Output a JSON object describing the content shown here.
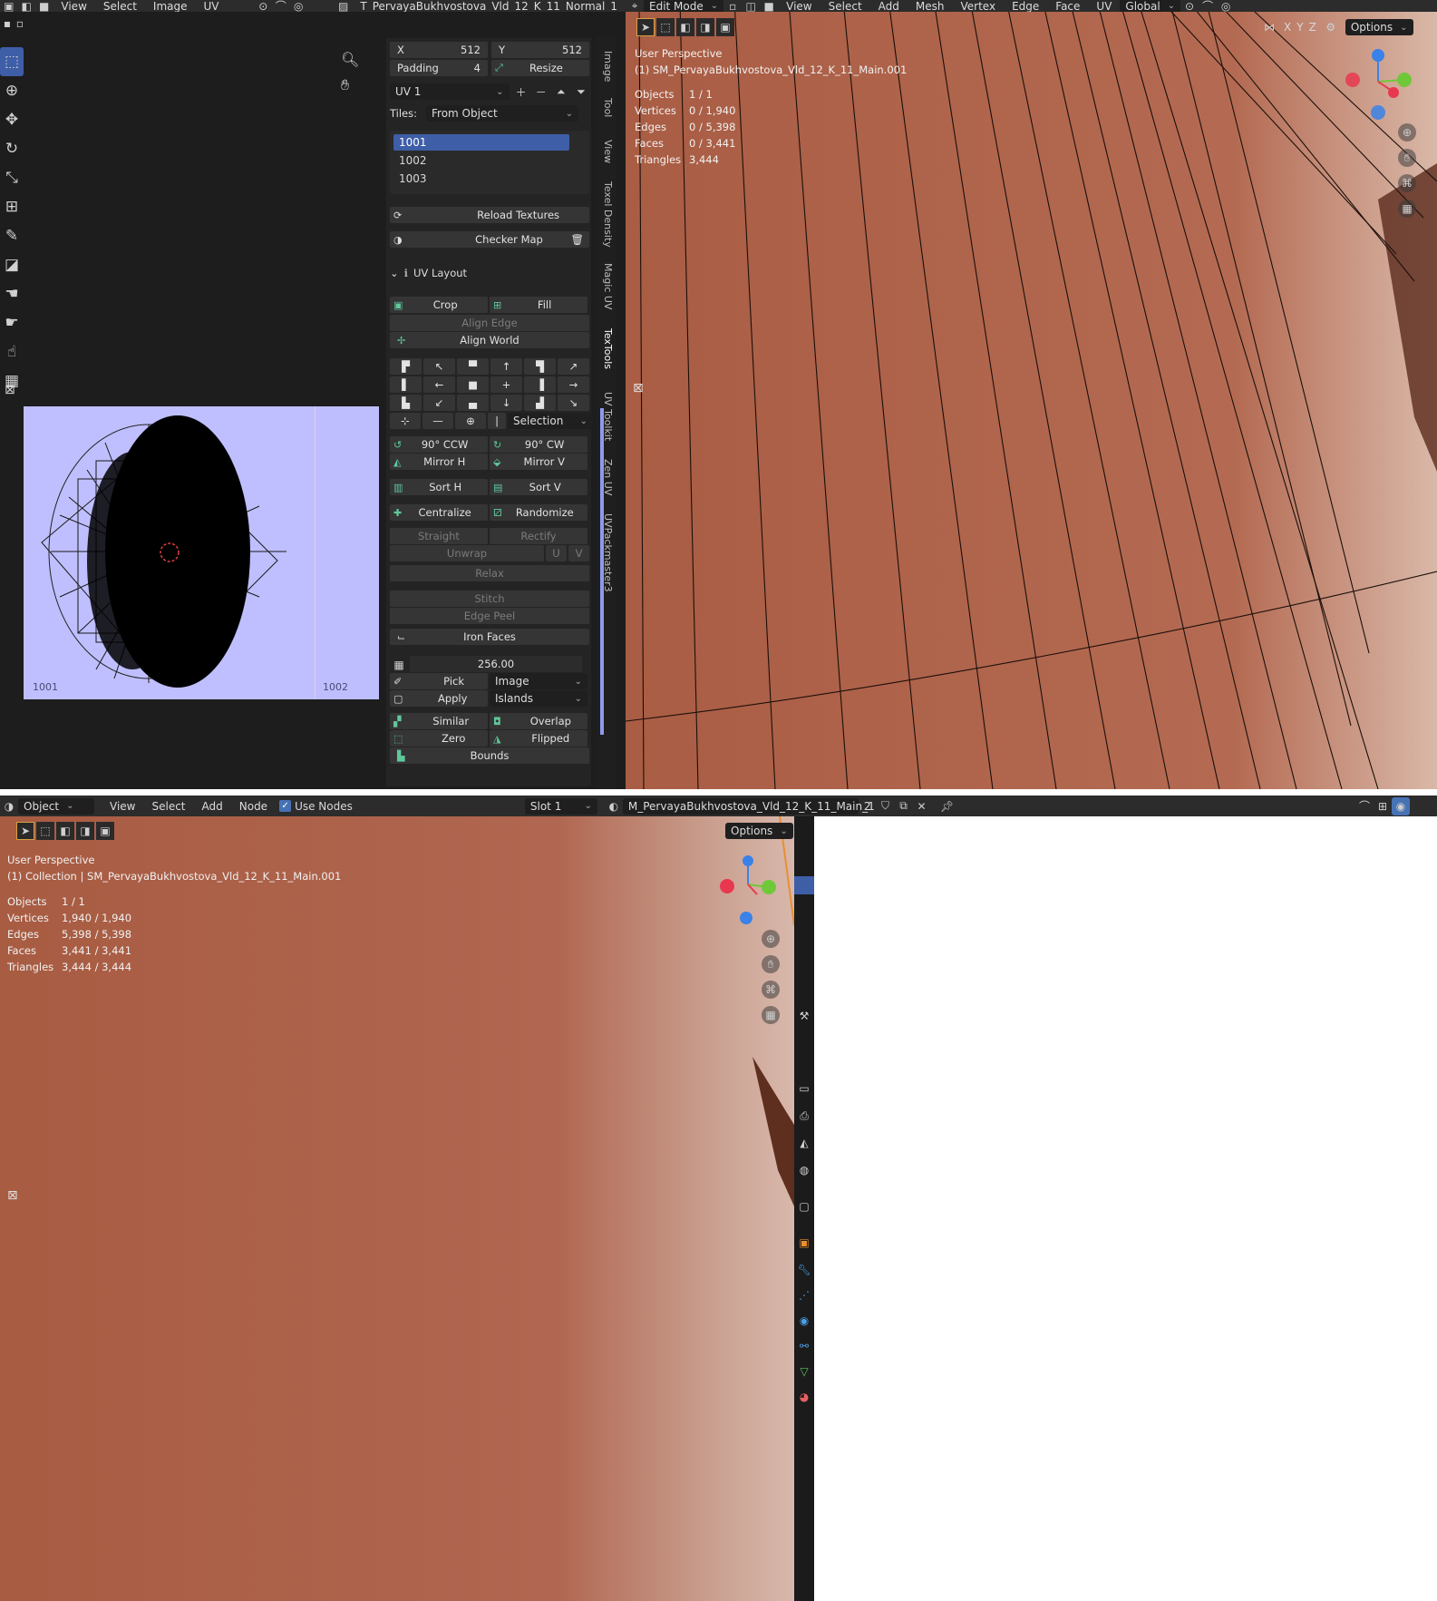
{
  "uv_editor": {
    "menu": [
      "View",
      "Select",
      "Image",
      "UV"
    ],
    "image_name": "T_PervayaBukhvostova_Vld_12_K_11_Normal_1",
    "tile_labels": [
      "1001",
      "1002"
    ]
  },
  "npanel": {
    "x_label": "X",
    "x_value": "512",
    "y_label": "Y",
    "y_value": "512",
    "padding_label": "Padding",
    "padding_value": "4",
    "resize_label": "Resize",
    "uv_map": "UV 1",
    "tiles_label": "Tiles:",
    "tiles_value": "From Object",
    "tile_list": [
      "1001",
      "1002",
      "1003"
    ],
    "reload_textures": "Reload Textures",
    "checker_map": "Checker Map",
    "uv_layout_title": "UV Layout",
    "crop": "Crop",
    "fill": "Fill",
    "align_edge": "Align Edge",
    "align_world": "Align World",
    "selection": "Selection",
    "rot_ccw": "90° CCW",
    "rot_cw": "90° CW",
    "mirror_h": "Mirror H",
    "mirror_v": "Mirror V",
    "sort_h": "Sort H",
    "sort_v": "Sort V",
    "centralize": "Centralize",
    "randomize": "Randomize",
    "straight": "Straight",
    "rectify": "Rectify",
    "unwrap": "Unwrap",
    "u": "U",
    "v": "V",
    "relax": "Relax",
    "stitch": "Stitch",
    "edge_peel": "Edge Peel",
    "iron_faces": "Iron Faces",
    "texel_value": "256.00",
    "pick": "Pick",
    "image": "Image",
    "apply": "Apply",
    "islands": "Islands",
    "similar": "Similar",
    "overlap": "Overlap",
    "zero": "Zero",
    "flipped": "Flipped",
    "bounds": "Bounds"
  },
  "side_tabs": [
    "Image",
    "Tool",
    "View",
    "Texel Density",
    "Magic UV",
    "TexTools",
    "UV Toolkit",
    "Zen UV",
    "UVPackmaster3"
  ],
  "viewport_top": {
    "mode": "Edit Mode",
    "menu": [
      "View",
      "Select",
      "Add",
      "Mesh",
      "Vertex",
      "Edge",
      "Face",
      "UV"
    ],
    "orientation": "Global",
    "axes": [
      "X",
      "Y",
      "Z"
    ],
    "options": "Options",
    "perspective": "User Perspective",
    "object_name": "(1) SM_PervayaBukhvostova_Vld_12_K_11_Main.001",
    "stats": [
      {
        "label": "Objects",
        "value": "1 / 1"
      },
      {
        "label": "Vertices",
        "value": "0 / 1,940"
      },
      {
        "label": "Edges",
        "value": "0 / 5,398"
      },
      {
        "label": "Faces",
        "value": "0 / 3,441"
      },
      {
        "label": "Triangles",
        "value": "3,444"
      }
    ]
  },
  "node_header": {
    "mode": "Object",
    "menu": [
      "View",
      "Select",
      "Add",
      "Node"
    ],
    "use_nodes": "Use Nodes",
    "slot": "Slot 1",
    "material": "M_PervayaBukhvostova_Vld_12_K_11_Main_1",
    "users": "2"
  },
  "viewport_bottom": {
    "options": "Options",
    "perspective": "User Perspective",
    "object_name": "(1) Collection | SM_PervayaBukhvostova_Vld_12_K_11_Main.001",
    "stats": [
      {
        "label": "Objects",
        "value": "1 / 1"
      },
      {
        "label": "Vertices",
        "value": "1,940 / 1,940"
      },
      {
        "label": "Edges",
        "value": "5,398 / 5,398"
      },
      {
        "label": "Faces",
        "value": "3,441 / 3,441"
      },
      {
        "label": "Triangles",
        "value": "3,444 / 3,444"
      }
    ]
  },
  "colors": {
    "accent": "#3f5ea8",
    "x_axis": "#e8384f",
    "y_axis": "#6fc83a",
    "z_axis": "#3a82e8",
    "mesh": "#b0634a"
  }
}
